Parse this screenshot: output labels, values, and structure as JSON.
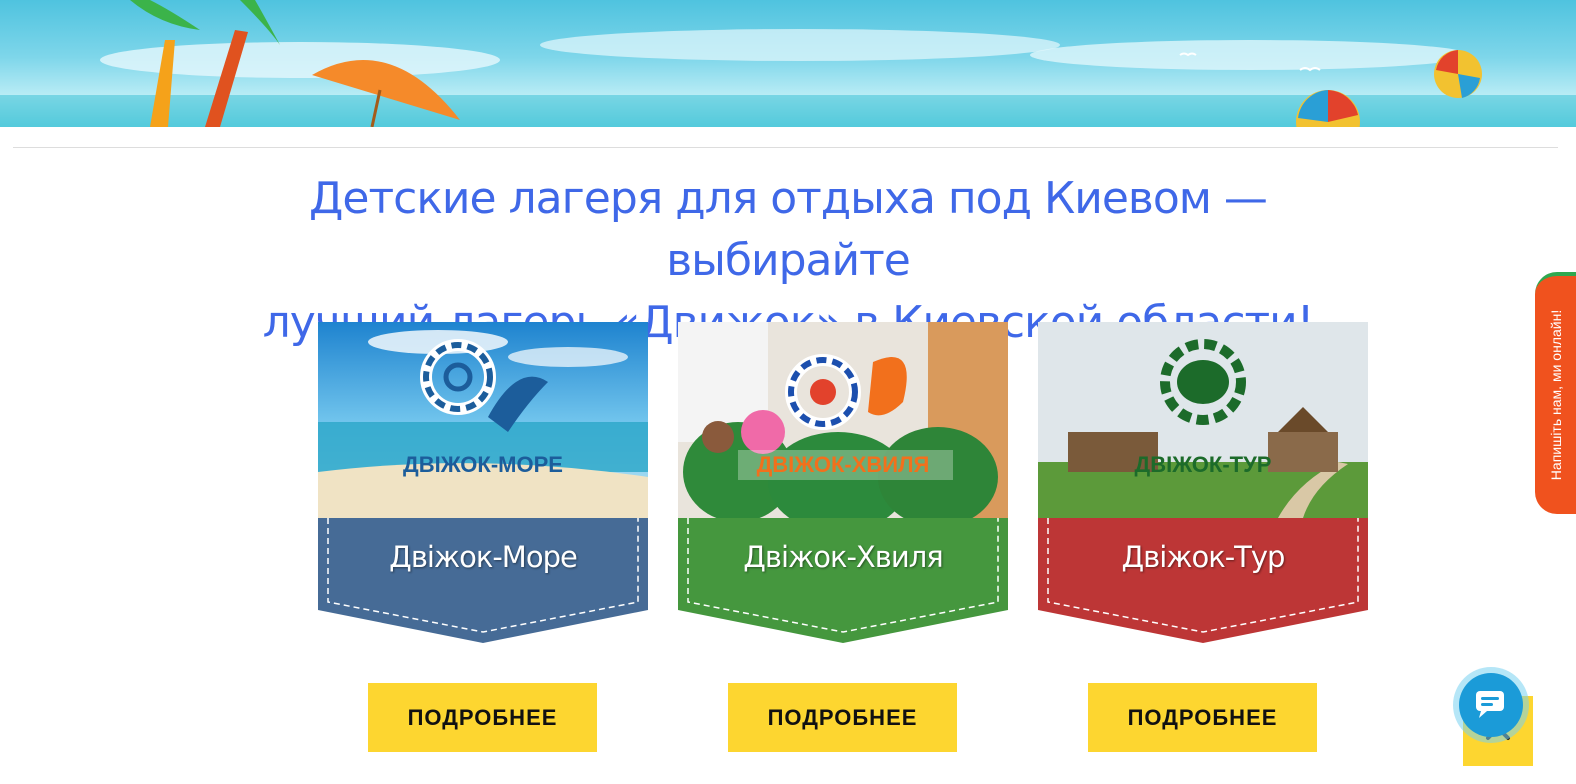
{
  "header": {
    "title_line1": "Детские лагеря для отдыха под Киевом — выбирайте",
    "title_line2": "лучший лагерь «Движок» в Киевской области!"
  },
  "camps": [
    {
      "logo_text": "ДВІЖОК-МОРЕ",
      "label": "Двіжок-Море",
      "ribbon_color": "#466b96",
      "logo_color": "#1c5d9b",
      "button": "ПОДРОБНЕЕ"
    },
    {
      "logo_text": "ДВІЖОК-ХВИЛЯ",
      "label": "Двіжок-Хвиля",
      "ribbon_color": "#45973e",
      "logo_color": "#f2701c",
      "button": "ПОДРОБНЕЕ"
    },
    {
      "logo_text": "ДВІЖОК-ТУР",
      "label": "Двіжок-Тур",
      "ribbon_color": "#bd3636",
      "logo_color": "#1c6b2a",
      "button": "ПОДРОБНЕЕ"
    }
  ],
  "side_tab": {
    "text": "Напишіть нам, ми онлайн!"
  },
  "colors": {
    "accent_yellow": "#fdd630",
    "title_blue": "#3f68e8",
    "side_tab_orange": "#f0521e"
  },
  "icons": [
    "chat-icon",
    "chevron-up-icon"
  ]
}
